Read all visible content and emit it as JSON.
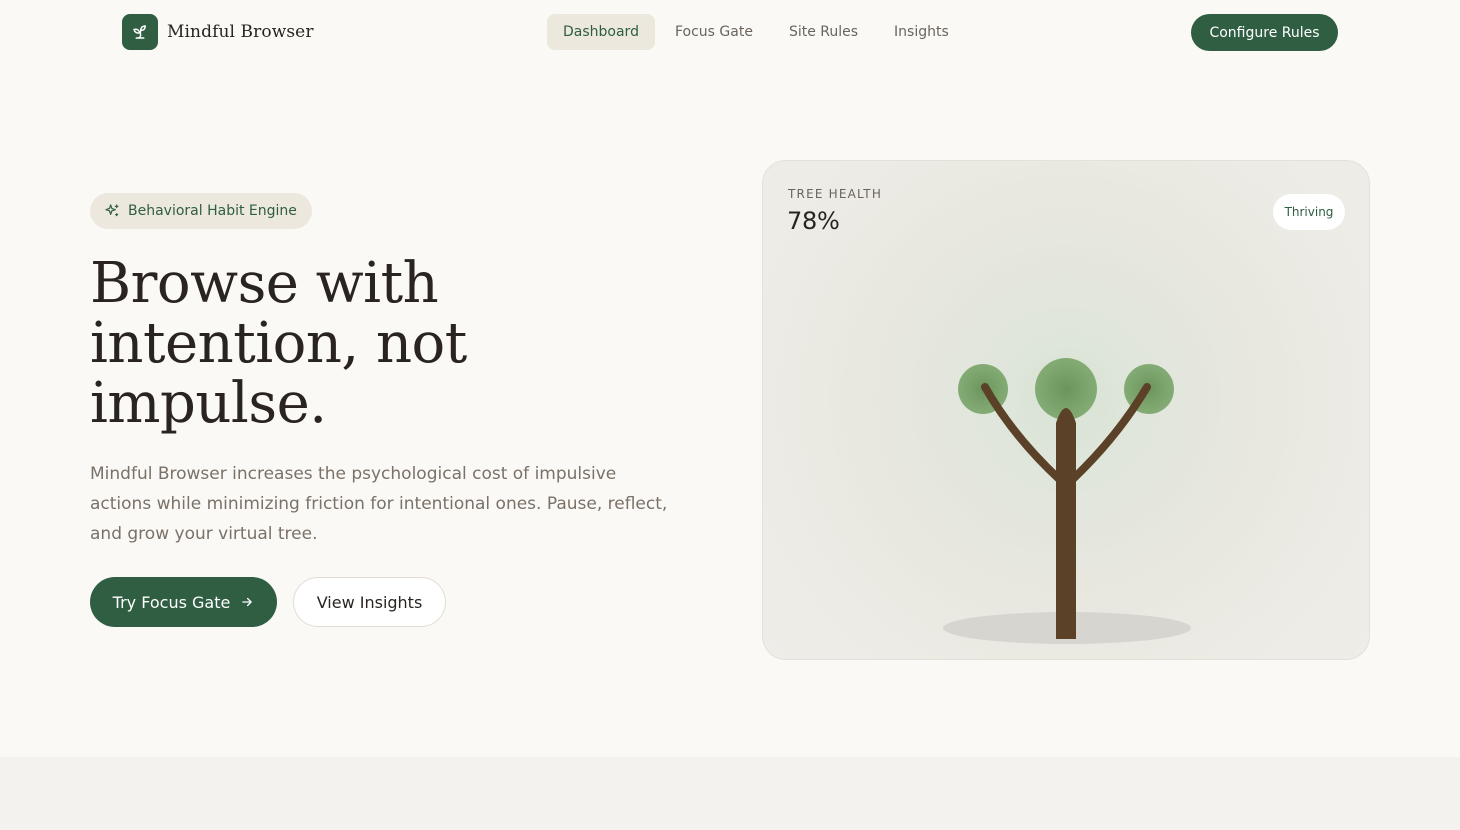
{
  "brand": {
    "name": "Mindful Browser",
    "logo_icon": "sprout-icon",
    "color": "#2f5e42"
  },
  "nav": {
    "links": [
      {
        "label": "Dashboard",
        "active": true
      },
      {
        "label": "Focus Gate",
        "active": false
      },
      {
        "label": "Site Rules",
        "active": false
      },
      {
        "label": "Insights",
        "active": false
      }
    ],
    "cta_label": "Configure Rules"
  },
  "hero": {
    "badge_icon": "sparkles-icon",
    "badge_label": "Behavioral Habit Engine",
    "title_lines": [
      "Browse with",
      "intention, not",
      "impulse."
    ],
    "description": "Mindful Browser increases the psychological cost of impulsive actions while minimizing friction for intentional ones. Pause, reflect, and grow your virtual tree.",
    "primary_button": "Try Focus Gate",
    "primary_button_icon": "arrow-right-icon",
    "secondary_button": "View Insights"
  },
  "tree_card": {
    "label": "TREE HEALTH",
    "value": "78%",
    "health_fraction": 0.78,
    "status": "Thriving",
    "colors": {
      "trunk": "#5a4128",
      "foliage": "#6f9a5e",
      "shadow": "#d6d5cf"
    }
  }
}
